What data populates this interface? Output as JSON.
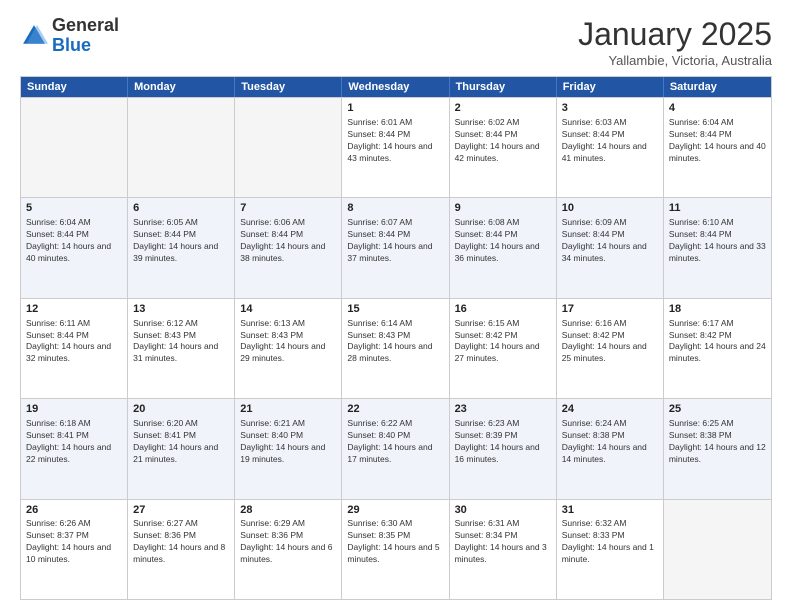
{
  "header": {
    "logo_general": "General",
    "logo_blue": "Blue",
    "month_title": "January 2025",
    "subtitle": "Yallambie, Victoria, Australia"
  },
  "calendar": {
    "weekdays": [
      "Sunday",
      "Monday",
      "Tuesday",
      "Wednesday",
      "Thursday",
      "Friday",
      "Saturday"
    ],
    "rows": [
      [
        {
          "day": "",
          "empty": true
        },
        {
          "day": "",
          "empty": true
        },
        {
          "day": "",
          "empty": true
        },
        {
          "day": "1",
          "sunrise": "Sunrise: 6:01 AM",
          "sunset": "Sunset: 8:44 PM",
          "daylight": "Daylight: 14 hours and 43 minutes."
        },
        {
          "day": "2",
          "sunrise": "Sunrise: 6:02 AM",
          "sunset": "Sunset: 8:44 PM",
          "daylight": "Daylight: 14 hours and 42 minutes."
        },
        {
          "day": "3",
          "sunrise": "Sunrise: 6:03 AM",
          "sunset": "Sunset: 8:44 PM",
          "daylight": "Daylight: 14 hours and 41 minutes."
        },
        {
          "day": "4",
          "sunrise": "Sunrise: 6:04 AM",
          "sunset": "Sunset: 8:44 PM",
          "daylight": "Daylight: 14 hours and 40 minutes."
        }
      ],
      [
        {
          "day": "5",
          "sunrise": "Sunrise: 6:04 AM",
          "sunset": "Sunset: 8:44 PM",
          "daylight": "Daylight: 14 hours and 40 minutes."
        },
        {
          "day": "6",
          "sunrise": "Sunrise: 6:05 AM",
          "sunset": "Sunset: 8:44 PM",
          "daylight": "Daylight: 14 hours and 39 minutes."
        },
        {
          "day": "7",
          "sunrise": "Sunrise: 6:06 AM",
          "sunset": "Sunset: 8:44 PM",
          "daylight": "Daylight: 14 hours and 38 minutes."
        },
        {
          "day": "8",
          "sunrise": "Sunrise: 6:07 AM",
          "sunset": "Sunset: 8:44 PM",
          "daylight": "Daylight: 14 hours and 37 minutes."
        },
        {
          "day": "9",
          "sunrise": "Sunrise: 6:08 AM",
          "sunset": "Sunset: 8:44 PM",
          "daylight": "Daylight: 14 hours and 36 minutes."
        },
        {
          "day": "10",
          "sunrise": "Sunrise: 6:09 AM",
          "sunset": "Sunset: 8:44 PM",
          "daylight": "Daylight: 14 hours and 34 minutes."
        },
        {
          "day": "11",
          "sunrise": "Sunrise: 6:10 AM",
          "sunset": "Sunset: 8:44 PM",
          "daylight": "Daylight: 14 hours and 33 minutes."
        }
      ],
      [
        {
          "day": "12",
          "sunrise": "Sunrise: 6:11 AM",
          "sunset": "Sunset: 8:44 PM",
          "daylight": "Daylight: 14 hours and 32 minutes."
        },
        {
          "day": "13",
          "sunrise": "Sunrise: 6:12 AM",
          "sunset": "Sunset: 8:43 PM",
          "daylight": "Daylight: 14 hours and 31 minutes."
        },
        {
          "day": "14",
          "sunrise": "Sunrise: 6:13 AM",
          "sunset": "Sunset: 8:43 PM",
          "daylight": "Daylight: 14 hours and 29 minutes."
        },
        {
          "day": "15",
          "sunrise": "Sunrise: 6:14 AM",
          "sunset": "Sunset: 8:43 PM",
          "daylight": "Daylight: 14 hours and 28 minutes."
        },
        {
          "day": "16",
          "sunrise": "Sunrise: 6:15 AM",
          "sunset": "Sunset: 8:42 PM",
          "daylight": "Daylight: 14 hours and 27 minutes."
        },
        {
          "day": "17",
          "sunrise": "Sunrise: 6:16 AM",
          "sunset": "Sunset: 8:42 PM",
          "daylight": "Daylight: 14 hours and 25 minutes."
        },
        {
          "day": "18",
          "sunrise": "Sunrise: 6:17 AM",
          "sunset": "Sunset: 8:42 PM",
          "daylight": "Daylight: 14 hours and 24 minutes."
        }
      ],
      [
        {
          "day": "19",
          "sunrise": "Sunrise: 6:18 AM",
          "sunset": "Sunset: 8:41 PM",
          "daylight": "Daylight: 14 hours and 22 minutes."
        },
        {
          "day": "20",
          "sunrise": "Sunrise: 6:20 AM",
          "sunset": "Sunset: 8:41 PM",
          "daylight": "Daylight: 14 hours and 21 minutes."
        },
        {
          "day": "21",
          "sunrise": "Sunrise: 6:21 AM",
          "sunset": "Sunset: 8:40 PM",
          "daylight": "Daylight: 14 hours and 19 minutes."
        },
        {
          "day": "22",
          "sunrise": "Sunrise: 6:22 AM",
          "sunset": "Sunset: 8:40 PM",
          "daylight": "Daylight: 14 hours and 17 minutes."
        },
        {
          "day": "23",
          "sunrise": "Sunrise: 6:23 AM",
          "sunset": "Sunset: 8:39 PM",
          "daylight": "Daylight: 14 hours and 16 minutes."
        },
        {
          "day": "24",
          "sunrise": "Sunrise: 6:24 AM",
          "sunset": "Sunset: 8:38 PM",
          "daylight": "Daylight: 14 hours and 14 minutes."
        },
        {
          "day": "25",
          "sunrise": "Sunrise: 6:25 AM",
          "sunset": "Sunset: 8:38 PM",
          "daylight": "Daylight: 14 hours and 12 minutes."
        }
      ],
      [
        {
          "day": "26",
          "sunrise": "Sunrise: 6:26 AM",
          "sunset": "Sunset: 8:37 PM",
          "daylight": "Daylight: 14 hours and 10 minutes."
        },
        {
          "day": "27",
          "sunrise": "Sunrise: 6:27 AM",
          "sunset": "Sunset: 8:36 PM",
          "daylight": "Daylight: 14 hours and 8 minutes."
        },
        {
          "day": "28",
          "sunrise": "Sunrise: 6:29 AM",
          "sunset": "Sunset: 8:36 PM",
          "daylight": "Daylight: 14 hours and 6 minutes."
        },
        {
          "day": "29",
          "sunrise": "Sunrise: 6:30 AM",
          "sunset": "Sunset: 8:35 PM",
          "daylight": "Daylight: 14 hours and 5 minutes."
        },
        {
          "day": "30",
          "sunrise": "Sunrise: 6:31 AM",
          "sunset": "Sunset: 8:34 PM",
          "daylight": "Daylight: 14 hours and 3 minutes."
        },
        {
          "day": "31",
          "sunrise": "Sunrise: 6:32 AM",
          "sunset": "Sunset: 8:33 PM",
          "daylight": "Daylight: 14 hours and 1 minute."
        },
        {
          "day": "",
          "empty": true
        }
      ]
    ]
  }
}
